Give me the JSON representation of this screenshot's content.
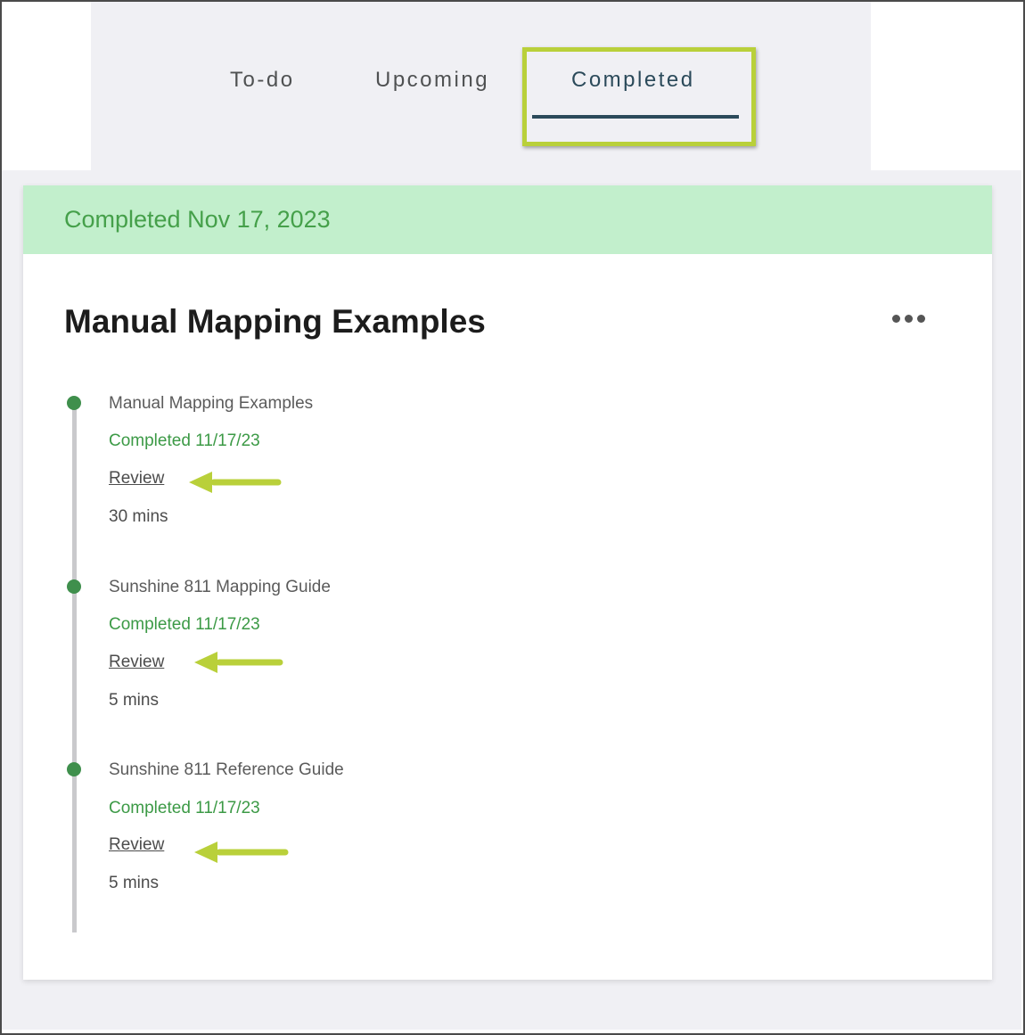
{
  "tabs": [
    {
      "label": "To-do",
      "active": false
    },
    {
      "label": "Upcoming",
      "active": false
    },
    {
      "label": "Completed",
      "active": true
    }
  ],
  "card": {
    "banner": "Completed Nov 17, 2023",
    "title": "Manual Mapping Examples",
    "more_icon": "more-horizontal-icon",
    "items": [
      {
        "title": "Manual Mapping Examples",
        "status": "Completed 11/17/23",
        "review": "Review",
        "duration": "30 mins"
      },
      {
        "title": "Sunshine 811 Mapping Guide",
        "status": "Completed 11/17/23",
        "review": "Review",
        "duration": "5 mins"
      },
      {
        "title": "Sunshine 811 Reference Guide",
        "status": "Completed 11/17/23",
        "review": "Review",
        "duration": "5 mins"
      }
    ]
  },
  "colors": {
    "accent": "#2b4a5a",
    "highlight": "#b9d03a",
    "banner_bg": "#c2efcc",
    "completed_green": "#3c9a46"
  }
}
